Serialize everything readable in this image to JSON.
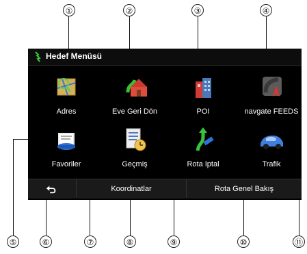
{
  "callouts": [
    "①",
    "②",
    "③",
    "④",
    "⑤",
    "⑥",
    "⑦",
    "⑧",
    "⑨",
    "⑩",
    "⑪"
  ],
  "header": {
    "title": "Hedef Menüsü"
  },
  "tiles": [
    {
      "label": "Adres"
    },
    {
      "label": "Eve Geri Dön"
    },
    {
      "label": "POI"
    },
    {
      "label": "navgate FEEDS"
    },
    {
      "label": "Favoriler"
    },
    {
      "label": "Geçmiş"
    },
    {
      "label": "Rota Iptal"
    },
    {
      "label": "Trafik"
    }
  ],
  "bottom_bar": {
    "back_icon": "back-arrow-icon",
    "coordinates_label": "Koordinatlar",
    "route_overview_label": "Rota Genel Bakış"
  }
}
